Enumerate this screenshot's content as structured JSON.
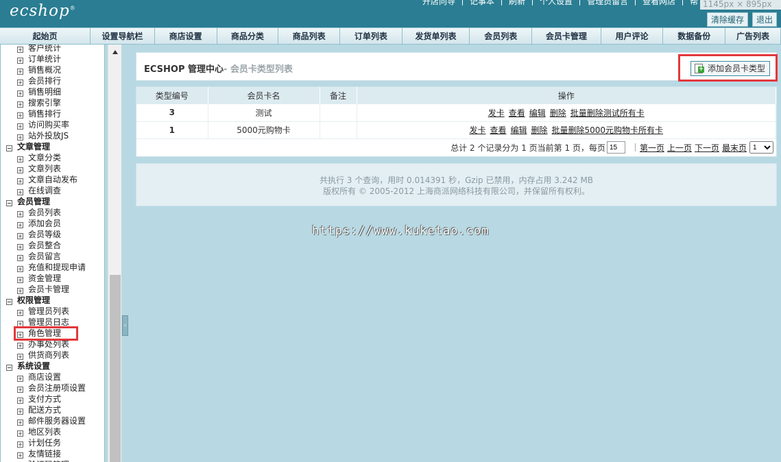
{
  "header": {
    "logo": "ecshop",
    "logo_mark": "®",
    "top_links": [
      "开店向导",
      "记事本",
      "刷新",
      "个人设置",
      "管理员留言",
      "查看网店",
      "帮"
    ],
    "dimension_badge": "1145px × 895px",
    "clear_cache": "清除缓存",
    "logout": "退出"
  },
  "tabs": [
    "起始页",
    "设置导航栏",
    "商店设置",
    "商品分类",
    "商品列表",
    "订单列表",
    "发货单列表",
    "会员列表",
    "会员卡管理",
    "用户评论",
    "数据备份",
    "广告列表"
  ],
  "sidebar": {
    "items": [
      {
        "t": "客户统计",
        "g": false
      },
      {
        "t": "订单统计",
        "g": false
      },
      {
        "t": "销售概况",
        "g": false
      },
      {
        "t": "会员排行",
        "g": false
      },
      {
        "t": "销售明细",
        "g": false
      },
      {
        "t": "搜索引擎",
        "g": false
      },
      {
        "t": "销售排行",
        "g": false
      },
      {
        "t": "访问购买率",
        "g": false
      },
      {
        "t": "站外投放JS",
        "g": false
      },
      {
        "t": "文章管理",
        "g": true
      },
      {
        "t": "文章分类",
        "g": false
      },
      {
        "t": "文章列表",
        "g": false
      },
      {
        "t": "文章自动发布",
        "g": false
      },
      {
        "t": "在线调查",
        "g": false
      },
      {
        "t": "会员管理",
        "g": true
      },
      {
        "t": "会员列表",
        "g": false
      },
      {
        "t": "添加会员",
        "g": false
      },
      {
        "t": "会员等级",
        "g": false
      },
      {
        "t": "会员整合",
        "g": false
      },
      {
        "t": "会员留言",
        "g": false
      },
      {
        "t": "充值和提现申请",
        "g": false
      },
      {
        "t": "资金管理",
        "g": false
      },
      {
        "t": "会员卡管理",
        "g": false
      },
      {
        "t": "权限管理",
        "g": true
      },
      {
        "t": "管理员列表",
        "g": false
      },
      {
        "t": "管理员日志",
        "g": false
      },
      {
        "t": "角色管理",
        "g": false
      },
      {
        "t": "办事处列表",
        "g": false
      },
      {
        "t": "供货商列表",
        "g": false
      },
      {
        "t": "系统设置",
        "g": true
      },
      {
        "t": "商店设置",
        "g": false
      },
      {
        "t": "会员注册项设置",
        "g": false
      },
      {
        "t": "支付方式",
        "g": false
      },
      {
        "t": "配送方式",
        "g": false
      },
      {
        "t": "邮件服务器设置",
        "g": false
      },
      {
        "t": "地区列表",
        "g": false
      },
      {
        "t": "计划任务",
        "g": false
      },
      {
        "t": "友情链接",
        "g": false
      },
      {
        "t": "验证码管理",
        "g": false
      }
    ]
  },
  "main": {
    "title": "ECSHOP 管理中心",
    "subtitle": "- 会员卡类型列表",
    "add_button": "添加会员卡类型",
    "columns": [
      "类型编号",
      "会员卡名",
      "备注",
      "操作"
    ],
    "rows": [
      {
        "id": "3",
        "name": "测试",
        "note": "",
        "ops": [
          "发卡",
          "查看",
          "编辑",
          "删除",
          "批量删除测试所有卡"
        ]
      },
      {
        "id": "1",
        "name": "5000元购物卡",
        "note": "",
        "ops": [
          "发卡",
          "查看",
          "编辑",
          "删除",
          "批量删除5000元购物卡所有卡"
        ]
      }
    ],
    "pager": {
      "summary": "总计 2 个记录分为 1 页当前第 1 页，每页",
      "per_page": "15",
      "first": "第一页",
      "prev": "上一页",
      "next": "下一页",
      "last": "最末页",
      "page_select": "1"
    },
    "footer_line1": "共执行 3 个查询，用时 0.014391 秒，Gzip 已禁用，内存占用 3.242 MB",
    "footer_line2": "版权所有 © 2005-2012 上海商派网络科技有限公司，并保留所有权利。"
  },
  "watermark": "https://www.kuketao.com"
}
